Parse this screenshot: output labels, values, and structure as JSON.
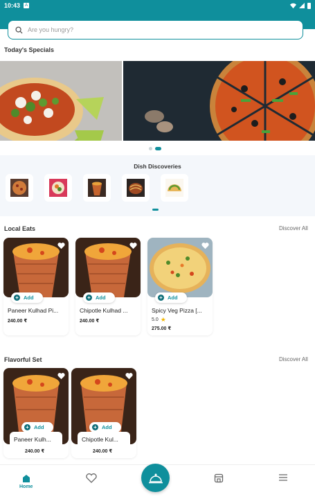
{
  "status_bar": {
    "time": "10:43",
    "badge": "A"
  },
  "search": {
    "placeholder": "Are you hungry?"
  },
  "specials": {
    "title": "Today's Specials",
    "banners": [
      "tacos",
      "pizza"
    ],
    "active_index": 1
  },
  "dish_discoveries": {
    "title": "Dish Discoveries",
    "items": [
      "pizza",
      "bowl",
      "kulhad",
      "noodles",
      "taco"
    ]
  },
  "local_eats": {
    "title": "Local Eats",
    "discover_label": "Discover All",
    "add_label": "Add",
    "items": [
      {
        "name": "Paneer Kulhad Pi...",
        "price": "240.00 ₹",
        "rating": ""
      },
      {
        "name": "Chipotle Kulhad ...",
        "price": "240.00 ₹",
        "rating": ""
      },
      {
        "name": "Spicy Veg Pizza [...",
        "price": "275.00 ₹",
        "rating": "5.0"
      }
    ]
  },
  "flavorful_set": {
    "title": "Flavorful Set",
    "discover_label": "Discover All",
    "add_label": "Add",
    "items": [
      {
        "name": "Paneer Kulh...",
        "price": "240.00 ₹"
      },
      {
        "name": "Chipotle Kul...",
        "price": "240.00 ₹"
      }
    ]
  },
  "bottom_nav": {
    "home_label": "Home",
    "items": [
      "home-icon",
      "heart-icon",
      "cloche-icon",
      "store-icon",
      "menu-icon"
    ]
  },
  "colors": {
    "accent": "#0f8f9c",
    "star": "#f2b705"
  }
}
